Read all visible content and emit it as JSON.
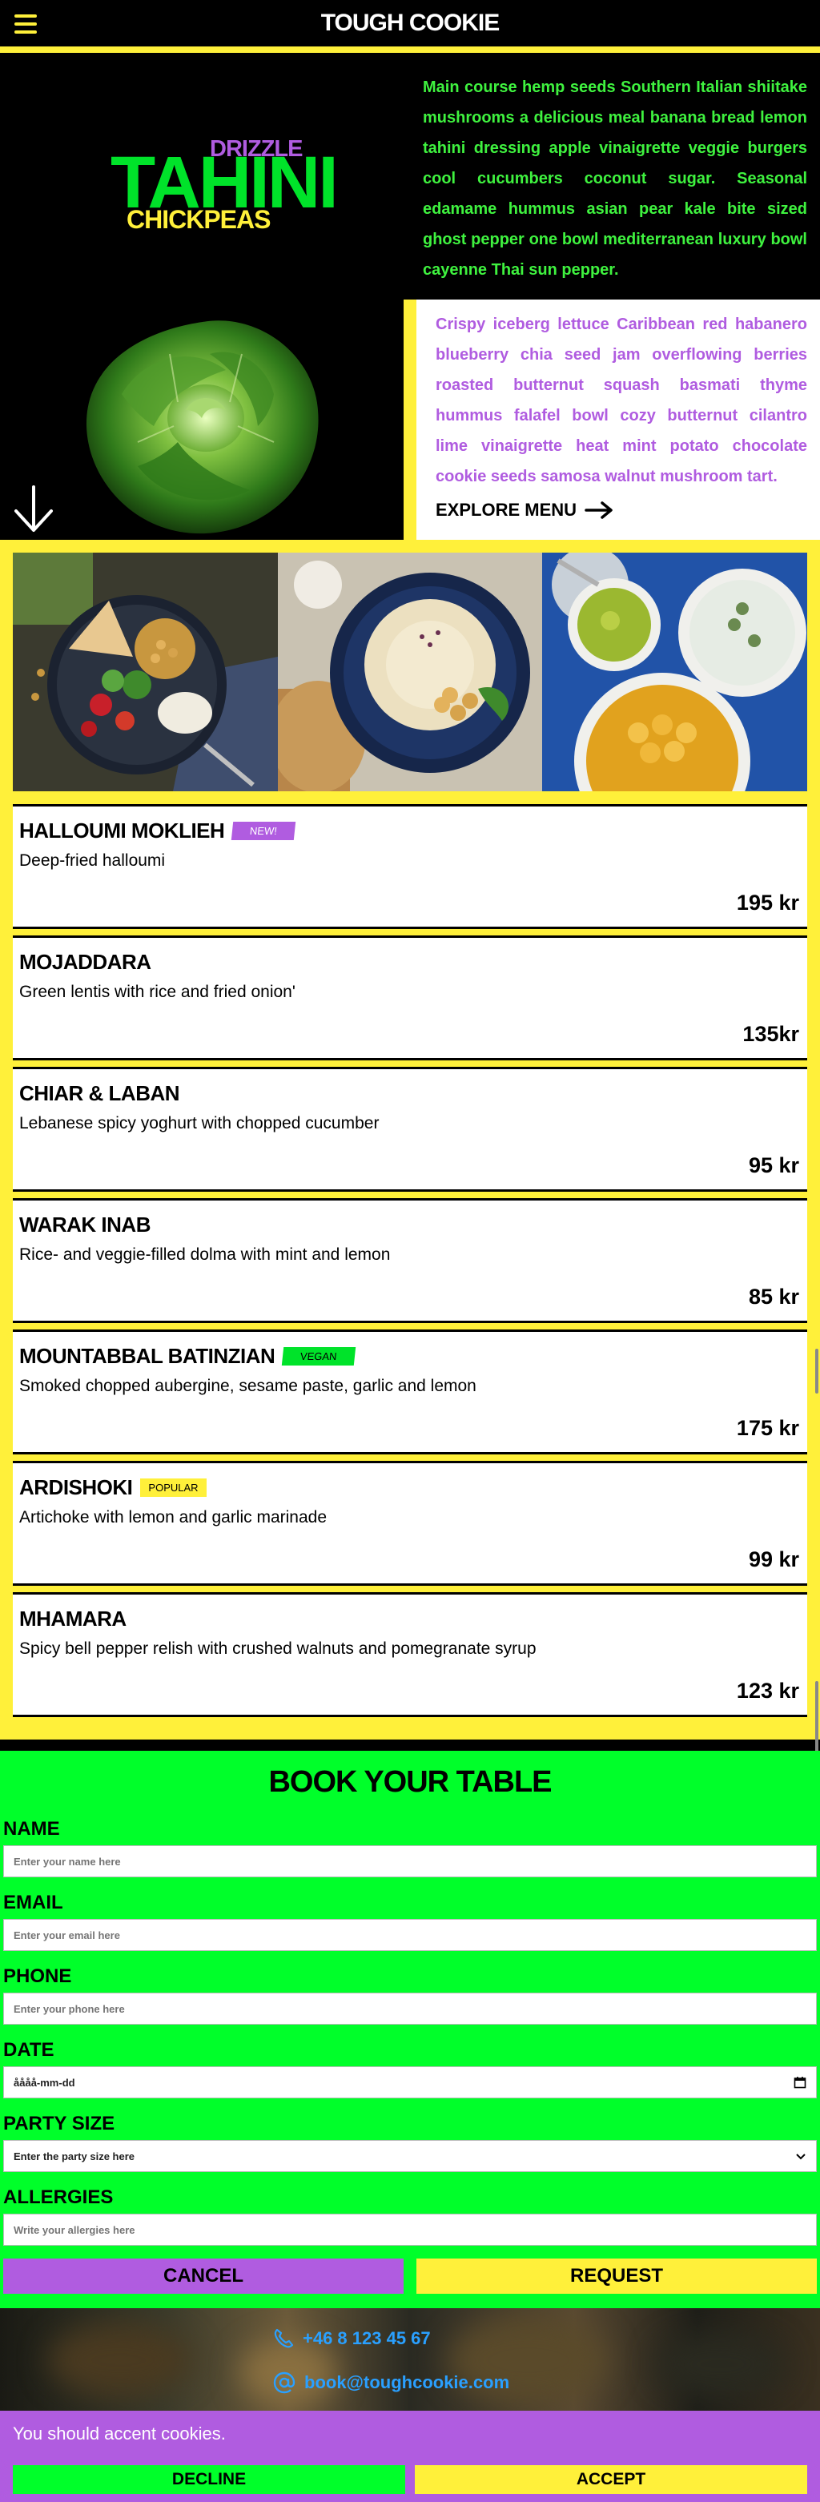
{
  "header": {
    "brand": "TOUGH COOKIE"
  },
  "hero": {
    "art": {
      "word_main": "TAHINI",
      "word_top": "DRIZZLE",
      "word_bottom": "CHICKPEAS"
    },
    "text_dark": "Main course hemp seeds Southern Italian shiitake mushrooms a delicious meal banana bread lemon tahini dressing apple vinaigrette veggie burgers cool cucumbers coconut sugar. Seasonal edamame hummus asian pear kale bite sized ghost pepper one bowl mediterranean luxury bowl cayenne Thai sun pepper.",
    "text_light": "Crispy iceberg lettuce Caribbean red habanero blueberry chia seed jam overflowing berries roasted butternut squash basmati thyme hummus falafel bowl cozy butternut cilantro lime vinaigrette heat mint potato chocolate cookie seeds samosa walnut mushroom tart.",
    "explore_label": "EXPLORE MENU"
  },
  "menu": {
    "items": [
      {
        "name": "HALLOUMI MOKLIEH",
        "badge": "NEW!",
        "desc": "Deep-fried halloumi",
        "price": "195 kr"
      },
      {
        "name": "MOJADDARA",
        "badge": "",
        "desc": "Green lentis with rice and fried onion'",
        "price": "135kr"
      },
      {
        "name": "CHIAR & LABAN",
        "badge": "",
        "desc": "Lebanese spicy yoghurt with chopped cucumber",
        "price": "95 kr"
      },
      {
        "name": "WARAK INAB",
        "badge": "",
        "desc": "Rice- and veggie-filled dolma with mint and lemon",
        "price": "85 kr"
      },
      {
        "name": "MOUNTABBAL BATINZIAN",
        "badge": "VEGAN",
        "desc": "Smoked chopped aubergine, sesame paste, garlic and lemon",
        "price": "175 kr"
      },
      {
        "name": "ARDISHOKI",
        "badge": "POPULAR",
        "desc": "Artichoke with lemon and garlic marinade",
        "price": "99 kr"
      },
      {
        "name": "MHAMARA",
        "badge": "",
        "desc": "Spicy bell pepper relish with crushed walnuts and pomegranate syrup",
        "price": "123 kr"
      }
    ]
  },
  "booking": {
    "title": "BOOK YOUR TABLE",
    "name_label": "NAME",
    "name_placeholder": "Enter your name here",
    "email_label": "EMAIL",
    "email_placeholder": "Enter your email here",
    "phone_label": "PHONE",
    "phone_placeholder": "Enter your phone here",
    "date_label": "DATE",
    "date_value": "åååå-mm-dd",
    "party_label": "PARTY SIZE",
    "party_value": "Enter the party size here",
    "allergies_label": "ALLERGIES",
    "allergies_placeholder": "Write your allergies here",
    "cancel_label": "CANCEL",
    "request_label": "REQUEST"
  },
  "contact": {
    "phone": "+46 8 123 45 67",
    "email": "book@toughcookie.com"
  },
  "cookie": {
    "message": "You should accent cookies.",
    "decline_label": "DECLINE",
    "accept_label": "ACCEPT"
  },
  "colors": {
    "yellow": "#fff03a",
    "green": "#00e32a",
    "bright_green": "#00ff2a",
    "purple": "#b05ce0",
    "link_blue": "#2aa0ff"
  },
  "icons": {
    "menu": "hamburger-icon",
    "scroll": "arrow-down-icon",
    "explore": "arrow-right-icon",
    "phone": "phone-icon",
    "email": "at-sign-icon",
    "calendar": "calendar-icon",
    "select": "chevron-down-icon"
  }
}
